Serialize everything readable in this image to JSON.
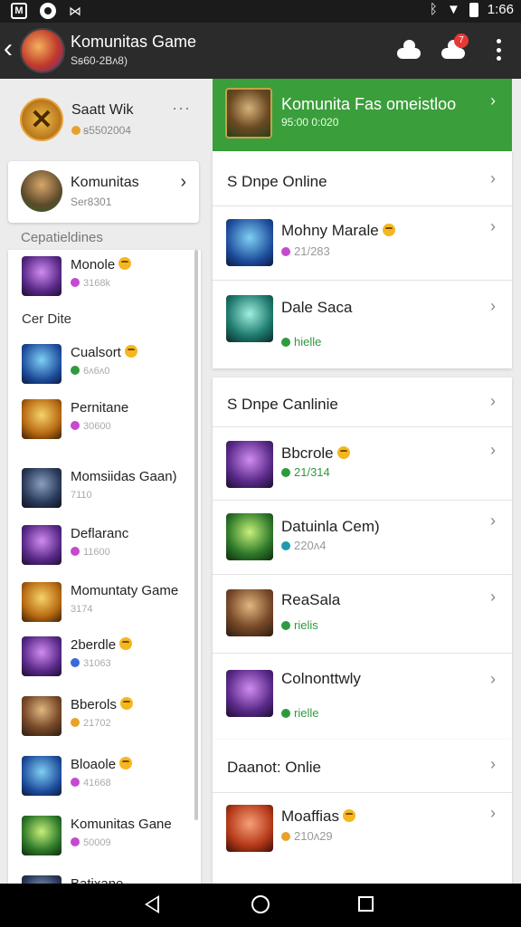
{
  "status_bar": {
    "time": "1:66"
  },
  "app_bar": {
    "title": "Komunitas Game",
    "subtitle": "Sꞩ60-2Bᴧ8)",
    "notif_count": "7"
  },
  "profile": {
    "name": "Saatt Wik",
    "meta": "ꞩ5502004"
  },
  "community": {
    "name": "Komunitas",
    "meta": "Ser8301"
  },
  "left_section_label": "Cepatieldines",
  "left_items": [
    {
      "name": "Monole",
      "meta": "3168k",
      "dot": "#c54ad0",
      "thumb": "t-purple",
      "emoji": true
    },
    {
      "name": "Cualsort",
      "meta": "6ᴧ6ᴧ0",
      "dot": "#2e9a3e",
      "thumb": "t-blue",
      "emoji": true
    },
    {
      "name": "Pernitane",
      "meta": "30600",
      "dot": "#c54ad0",
      "thumb": "t-gold",
      "emoji": false
    },
    {
      "name": "Momsiidas Gaan)",
      "meta": "7110",
      "dot": "",
      "thumb": "t-dark",
      "emoji": false
    },
    {
      "name": "Deflaranc",
      "meta": "11600",
      "dot": "#c54ad0",
      "thumb": "t-purple",
      "emoji": false
    },
    {
      "name": "Momuntaty Game",
      "meta": "3174",
      "dot": "",
      "thumb": "t-gold",
      "emoji": false
    },
    {
      "name": "2berdle",
      "meta": "31063",
      "dot": "#3a6ad8",
      "thumb": "t-purple",
      "emoji": true
    },
    {
      "name": "Bberols",
      "meta": "21702",
      "dot": "#e8a22c",
      "thumb": "t-warrior",
      "emoji": true
    },
    {
      "name": "Bloaole",
      "meta": "41668",
      "dot": "#c54ad0",
      "thumb": "t-blue",
      "emoji": true
    },
    {
      "name": "Komunitas Gane",
      "meta": "50009",
      "dot": "#c54ad0",
      "thumb": "t-green",
      "emoji": false
    },
    {
      "name": "Batixane",
      "meta": "",
      "dot": "",
      "thumb": "t-dark",
      "emoji": false
    }
  ],
  "left_subheading": "Cer Dite",
  "featured": {
    "name": "Komunita Fas omeistloo",
    "meta": "95:00 0:020"
  },
  "section1": {
    "heading": "S Dnpe Online",
    "items": [
      {
        "name": "Mohny Marale",
        "meta": "21/283",
        "dot": "#c54ad0",
        "thumb": "t-blue",
        "emoji": true,
        "green": false
      },
      {
        "name": "Dale Saca",
        "meta": "hielle",
        "dot": "#2e9a3e",
        "thumb": "t-teal",
        "emoji": false,
        "green": true
      }
    ]
  },
  "section2": {
    "heading": "S Dnpe Canlinie",
    "items": [
      {
        "name": "Bbcrole",
        "meta": "21/314",
        "dot": "#2e9a3e",
        "thumb": "t-purple",
        "emoji": true,
        "green": true
      },
      {
        "name": "Datuinla Cem)",
        "meta": "220ᴧ4",
        "dot": "#1e9ab0",
        "thumb": "t-green",
        "emoji": false,
        "green": false
      },
      {
        "name": "ReaSala",
        "meta": "rielis",
        "dot": "#2e9a3e",
        "thumb": "t-warrior",
        "emoji": false,
        "green": true
      },
      {
        "name": "Colnonttwly",
        "meta": "rielle",
        "dot": "#2e9a3e",
        "thumb": "t-purple",
        "emoji": false,
        "green": true
      }
    ]
  },
  "section3": {
    "heading": "Daanot: Onlie",
    "items": [
      {
        "name": "Moaffias",
        "meta": "210ᴧ29",
        "dot": "#e8a22c",
        "thumb": "t-red",
        "emoji": true,
        "green": false
      }
    ]
  }
}
